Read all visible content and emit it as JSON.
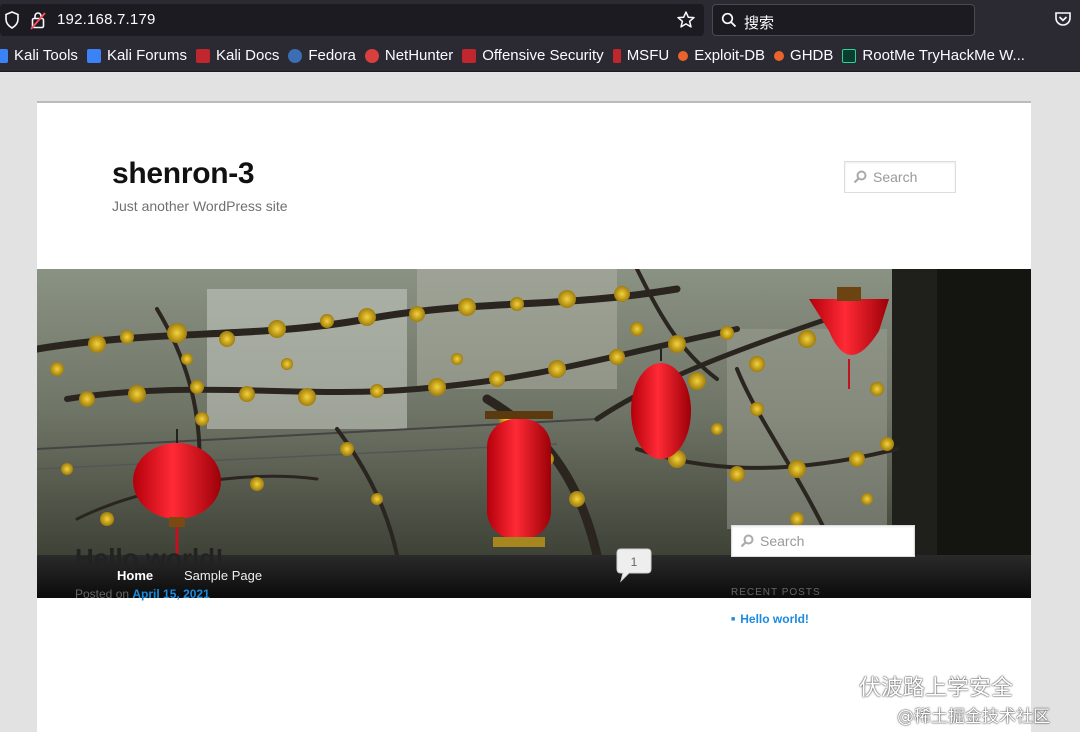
{
  "browser": {
    "url": "192.168.7.179",
    "search_placeholder": "搜索"
  },
  "bookmarks": [
    {
      "label": "Kali Tools",
      "color": "#3b82f6"
    },
    {
      "label": "Kali Forums",
      "color": "#3b82f6"
    },
    {
      "label": "Kali Docs",
      "color": "#c0262d"
    },
    {
      "label": "Fedora",
      "color": "#3c6eb4"
    },
    {
      "label": "NetHunter",
      "color": "#d93f3f"
    },
    {
      "label": "Offensive Security",
      "color": "#c0262d"
    },
    {
      "label": "MSFU",
      "color": "#c0262d"
    },
    {
      "label": "Exploit-DB",
      "color": "#e9632c"
    },
    {
      "label": "GHDB",
      "color": "#e9632c"
    },
    {
      "label": "RootMe TryHackMe W...",
      "color": "#0b3d2e"
    }
  ],
  "site": {
    "title": "shenron-3",
    "description": "Just another WordPress site",
    "search_placeholder": "Search"
  },
  "nav": {
    "home": "Home",
    "sample_page": "Sample Page"
  },
  "post": {
    "title": "Hello world!",
    "comment_count": "1",
    "posted_on_label": "Posted on",
    "date": "April 15, 2021"
  },
  "sidebar": {
    "search_placeholder": "Search",
    "recent_posts_title": "RECENT POSTS",
    "recent_posts": [
      "Hello world!"
    ]
  },
  "watermark": {
    "main": "伏波路上学安全",
    "sub": "@稀土掘金技术社区"
  },
  "colors": {
    "chrome_bg": "#2b2a33",
    "link": "#1b8be0",
    "nav_bg": "#111111"
  }
}
